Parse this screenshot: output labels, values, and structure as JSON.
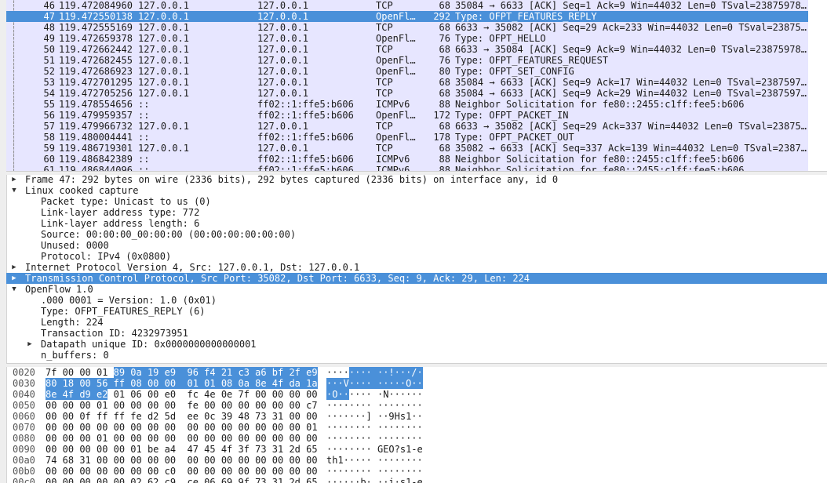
{
  "packets": [
    {
      "no": "46",
      "time": "119.472084960",
      "src": "127.0.0.1",
      "dst": "127.0.0.1",
      "proto": "TCP",
      "len": "68",
      "info": "35084 → 6633 [ACK] Seq=1 Ack=9 Win=44032 Len=0 TSval=23875978…"
    },
    {
      "no": "47",
      "time": "119.472550138",
      "src": "127.0.0.1",
      "dst": "127.0.0.1",
      "proto": "OpenFl…",
      "len": "292",
      "info": "Type: OFPT_FEATURES_REPLY"
    },
    {
      "no": "48",
      "time": "119.472555169",
      "src": "127.0.0.1",
      "dst": "127.0.0.1",
      "proto": "TCP",
      "len": "68",
      "info": "6633 → 35082 [ACK] Seq=29 Ack=233 Win=44032 Len=0 TSval=23875…"
    },
    {
      "no": "49",
      "time": "119.472659378",
      "src": "127.0.0.1",
      "dst": "127.0.0.1",
      "proto": "OpenFl…",
      "len": "76",
      "info": "Type: OFPT_HELLO"
    },
    {
      "no": "50",
      "time": "119.472662442",
      "src": "127.0.0.1",
      "dst": "127.0.0.1",
      "proto": "TCP",
      "len": "68",
      "info": "6633 → 35084 [ACK] Seq=9 Ack=9 Win=44032 Len=0 TSval=23875978…"
    },
    {
      "no": "51",
      "time": "119.472682455",
      "src": "127.0.0.1",
      "dst": "127.0.0.1",
      "proto": "OpenFl…",
      "len": "76",
      "info": "Type: OFPT_FEATURES_REQUEST"
    },
    {
      "no": "52",
      "time": "119.472686923",
      "src": "127.0.0.1",
      "dst": "127.0.0.1",
      "proto": "OpenFl…",
      "len": "80",
      "info": "Type: OFPT_SET_CONFIG"
    },
    {
      "no": "53",
      "time": "119.472701295",
      "src": "127.0.0.1",
      "dst": "127.0.0.1",
      "proto": "TCP",
      "len": "68",
      "info": "35084 → 6633 [ACK] Seq=9 Ack=17 Win=44032 Len=0 TSval=2387597…"
    },
    {
      "no": "54",
      "time": "119.472705256",
      "src": "127.0.0.1",
      "dst": "127.0.0.1",
      "proto": "TCP",
      "len": "68",
      "info": "35084 → 6633 [ACK] Seq=9 Ack=29 Win=44032 Len=0 TSval=2387597…"
    },
    {
      "no": "55",
      "time": "119.478554656",
      "src": "::",
      "dst": "ff02::1:ffe5:b606",
      "proto": "ICMPv6",
      "len": "88",
      "info": "Neighbor Solicitation for fe80::2455:c1ff:fee5:b606"
    },
    {
      "no": "56",
      "time": "119.479959357",
      "src": "::",
      "dst": "ff02::1:ffe5:b606",
      "proto": "OpenFl…",
      "len": "172",
      "info": "Type: OFPT_PACKET_IN"
    },
    {
      "no": "57",
      "time": "119.479966732",
      "src": "127.0.0.1",
      "dst": "127.0.0.1",
      "proto": "TCP",
      "len": "68",
      "info": "6633 → 35082 [ACK] Seq=29 Ack=337 Win=44032 Len=0 TSval=23875…"
    },
    {
      "no": "58",
      "time": "119.480004441",
      "src": "::",
      "dst": "ff02::1:ffe5:b606",
      "proto": "OpenFl…",
      "len": "178",
      "info": "Type: OFPT_PACKET_OUT"
    },
    {
      "no": "59",
      "time": "119.486719301",
      "src": "127.0.0.1",
      "dst": "127.0.0.1",
      "proto": "TCP",
      "len": "68",
      "info": "35082 → 6633 [ACK] Seq=337 Ack=139 Win=44032 Len=0 TSval=2387…"
    },
    {
      "no": "60",
      "time": "119.486842389",
      "src": "::",
      "dst": "ff02::1:ffe5:b606",
      "proto": "ICMPv6",
      "len": "88",
      "info": "Neighbor Solicitation for fe80::2455:c1ff:fee5:b606"
    },
    {
      "no": "61",
      "time": "119.486844096",
      "src": "::",
      "dst": "ff02::1:ffe5:b606",
      "proto": "ICMPv6",
      "len": "88",
      "info": "Neighbor Solicitation for fe80::2455:c1ff:fee5:b606"
    }
  ],
  "selected_packet": "47",
  "details": [
    {
      "indent": 0,
      "arrow": "right",
      "text": "Frame 47: 292 bytes on wire (2336 bits), 292 bytes captured (2336 bits) on interface any, id 0"
    },
    {
      "indent": 0,
      "arrow": "down",
      "text": "Linux cooked capture"
    },
    {
      "indent": 1,
      "arrow": "",
      "text": "Packet type: Unicast to us (0)"
    },
    {
      "indent": 1,
      "arrow": "",
      "text": "Link-layer address type: 772"
    },
    {
      "indent": 1,
      "arrow": "",
      "text": "Link-layer address length: 6"
    },
    {
      "indent": 1,
      "arrow": "",
      "text": "Source: 00:00:00_00:00:00 (00:00:00:00:00:00)"
    },
    {
      "indent": 1,
      "arrow": "",
      "text": "Unused: 0000"
    },
    {
      "indent": 1,
      "arrow": "",
      "text": "Protocol: IPv4 (0x0800)"
    },
    {
      "indent": 0,
      "arrow": "right",
      "text": "Internet Protocol Version 4, Src: 127.0.0.1, Dst: 127.0.0.1"
    },
    {
      "indent": 0,
      "arrow": "right",
      "text": "Transmission Control Protocol, Src Port: 35082, Dst Port: 6633, Seq: 9, Ack: 29, Len: 224",
      "selected": true
    },
    {
      "indent": 0,
      "arrow": "down",
      "text": "OpenFlow 1.0"
    },
    {
      "indent": 1,
      "arrow": "",
      "text": ".000 0001 = Version: 1.0 (0x01)"
    },
    {
      "indent": 1,
      "arrow": "",
      "text": "Type: OFPT_FEATURES_REPLY (6)"
    },
    {
      "indent": 1,
      "arrow": "",
      "text": "Length: 224"
    },
    {
      "indent": 1,
      "arrow": "",
      "text": "Transaction ID: 4232973951"
    },
    {
      "indent": 1,
      "arrow": "right",
      "text": "Datapath unique ID: 0x0000000000000001"
    },
    {
      "indent": 1,
      "arrow": "",
      "text": "n_buffers: 0"
    }
  ],
  "bytes": [
    {
      "offset": "0020",
      "hex": [
        "7f",
        "00",
        "00",
        "01",
        "89",
        "0a",
        "19",
        "e9",
        "96",
        "f4",
        "21",
        "c3",
        "a6",
        "bf",
        "2f",
        "e9"
      ],
      "ascii": "········ ··!···/·",
      "hl_from": 4,
      "hl_to": 16
    },
    {
      "offset": "0030",
      "hex": [
        "80",
        "18",
        "00",
        "56",
        "ff",
        "08",
        "00",
        "00",
        "01",
        "01",
        "08",
        "0a",
        "8e",
        "4f",
        "da",
        "1a"
      ],
      "ascii": "···V···· ·····O··",
      "hl_from": 0,
      "hl_to": 16
    },
    {
      "offset": "0040",
      "hex": [
        "8e",
        "4f",
        "d9",
        "e2",
        "01",
        "06",
        "00",
        "e0",
        "fc",
        "4e",
        "0e",
        "7f",
        "00",
        "00",
        "00",
        "00"
      ],
      "ascii": "·O······ ·N······",
      "hl_from": 0,
      "hl_to": 4
    },
    {
      "offset": "0050",
      "hex": [
        "00",
        "00",
        "00",
        "01",
        "00",
        "00",
        "00",
        "00",
        "fe",
        "00",
        "00",
        "00",
        "00",
        "00",
        "00",
        "c7"
      ],
      "ascii": "········ ········",
      "hl_from": 0,
      "hl_to": 0
    },
    {
      "offset": "0060",
      "hex": [
        "00",
        "00",
        "0f",
        "ff",
        "ff",
        "fe",
        "d2",
        "5d",
        "ee",
        "0c",
        "39",
        "48",
        "73",
        "31",
        "00",
        "00"
      ],
      "ascii": "·······] ··9Hs1··",
      "hl_from": 0,
      "hl_to": 0
    },
    {
      "offset": "0070",
      "hex": [
        "00",
        "00",
        "00",
        "00",
        "00",
        "00",
        "00",
        "00",
        "00",
        "00",
        "00",
        "00",
        "00",
        "00",
        "00",
        "01"
      ],
      "ascii": "········ ········",
      "hl_from": 0,
      "hl_to": 0
    },
    {
      "offset": "0080",
      "hex": [
        "00",
        "00",
        "00",
        "01",
        "00",
        "00",
        "00",
        "00",
        "00",
        "00",
        "00",
        "00",
        "00",
        "00",
        "00",
        "00"
      ],
      "ascii": "········ ········",
      "hl_from": 0,
      "hl_to": 0
    },
    {
      "offset": "0090",
      "hex": [
        "00",
        "00",
        "00",
        "00",
        "00",
        "01",
        "be",
        "a4",
        "47",
        "45",
        "4f",
        "3f",
        "73",
        "31",
        "2d",
        "65"
      ],
      "ascii": "········ GEO?s1-e",
      "hl_from": 0,
      "hl_to": 0
    },
    {
      "offset": "00a0",
      "hex": [
        "74",
        "68",
        "31",
        "00",
        "00",
        "00",
        "00",
        "00",
        "00",
        "00",
        "00",
        "00",
        "00",
        "00",
        "00",
        "00"
      ],
      "ascii": "th1····· ········",
      "hl_from": 0,
      "hl_to": 0
    },
    {
      "offset": "00b0",
      "hex": [
        "00",
        "00",
        "00",
        "00",
        "00",
        "00",
        "00",
        "c0",
        "00",
        "00",
        "00",
        "00",
        "00",
        "00",
        "00",
        "00"
      ],
      "ascii": "········ ········",
      "hl_from": 0,
      "hl_to": 0
    },
    {
      "offset": "00c0",
      "hex": [
        "00",
        "00",
        "00",
        "00",
        "00",
        "02",
        "62",
        "c9",
        "ce",
        "06",
        "69",
        "9f",
        "73",
        "31",
        "2d",
        "65"
      ],
      "ascii": "······b· ··i·s1-e",
      "hl_from": 0,
      "hl_to": 0
    }
  ],
  "colors": {
    "selection": "#4a90d9",
    "row_bg": "#e7e6ff"
  }
}
